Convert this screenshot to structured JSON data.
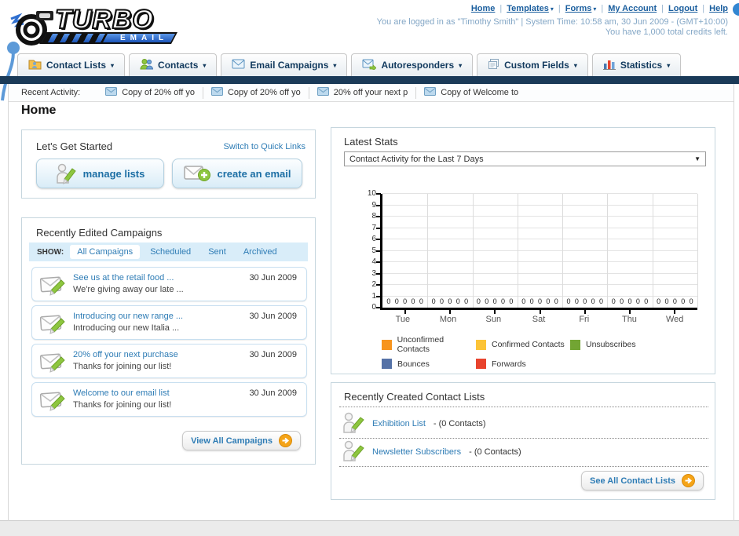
{
  "icons": {
    "chevron": "▾",
    "select_arrow": "▼",
    "separator": "|"
  },
  "header": {
    "logo_line1": "TURBO",
    "logo_line2": "EMAIL",
    "top_links": [
      {
        "label": "Home",
        "dropdown": false
      },
      {
        "label": "Templates",
        "dropdown": true
      },
      {
        "label": "Forms",
        "dropdown": true
      },
      {
        "label": "My Account",
        "dropdown": false
      },
      {
        "label": "Logout",
        "dropdown": false
      },
      {
        "label": "Help",
        "dropdown": false
      }
    ],
    "login_info": "You are logged in as \"Timothy Smith\" | System Time: 10:58 am, 30 Jun 2009 - (GMT+10:00)",
    "credits_info": "You have 1,000 total credits left."
  },
  "nav": {
    "tabs": [
      {
        "label": "Contact Lists",
        "icon": "contact-lists-folder-icon"
      },
      {
        "label": "Contacts",
        "icon": "contacts-people-icon"
      },
      {
        "label": "Email Campaigns",
        "icon": "envelope-icon"
      },
      {
        "label": "Autoresponders",
        "icon": "envelope-arrow-icon"
      },
      {
        "label": "Custom Fields",
        "icon": "pages-icon"
      },
      {
        "label": "Statistics",
        "icon": "bar-chart-icon"
      }
    ]
  },
  "recent_activity": {
    "label": "Recent Activity:",
    "items": [
      "Copy of 20% off yo",
      "Copy of 20% off yo",
      "20% off your next p",
      "Copy of Welcome to"
    ]
  },
  "page_title": "Home",
  "get_started": {
    "title": "Let's Get Started",
    "switch_link": "Switch to Quick Links",
    "manage_lists_label": "manage lists",
    "create_email_label": "create an email"
  },
  "campaigns": {
    "title": "Recently Edited Campaigns",
    "show_label": "SHOW:",
    "tabs": [
      {
        "label": "All Campaigns",
        "active": true
      },
      {
        "label": "Scheduled",
        "active": false
      },
      {
        "label": "Sent",
        "active": false
      },
      {
        "label": "Archived",
        "active": false
      }
    ],
    "items": [
      {
        "title": "See us at the retail food ...",
        "subtitle": "We're giving away our late ...",
        "date": "30 Jun 2009"
      },
      {
        "title": "Introducing our new range ...",
        "subtitle": "Introducing our new Italia ...",
        "date": "30 Jun 2009"
      },
      {
        "title": "20% off your next purchase",
        "subtitle": "Thanks for joining our list!",
        "date": "30 Jun 2009"
      },
      {
        "title": "Welcome to our email list",
        "subtitle": "Thanks for joining our list!",
        "date": "30 Jun 2009"
      }
    ],
    "view_all_label": "View All Campaigns"
  },
  "stats": {
    "title": "Latest Stats",
    "dropdown_value": "Contact Activity for the Last 7 Days"
  },
  "chart_data": {
    "type": "bar",
    "categories": [
      "Tue",
      "Mon",
      "Sun",
      "Sat",
      "Fri",
      "Thu",
      "Wed"
    ],
    "series": [
      {
        "name": "Unconfirmed Contacts",
        "color": "#f7941d",
        "values": [
          0,
          0,
          0,
          0,
          0,
          0,
          0
        ]
      },
      {
        "name": "Confirmed Contacts",
        "color": "#fcc438",
        "values": [
          0,
          0,
          0,
          0,
          0,
          0,
          0
        ]
      },
      {
        "name": "Unsubscribes",
        "color": "#72a533",
        "values": [
          0,
          0,
          0,
          0,
          0,
          0,
          0
        ]
      },
      {
        "name": "Bounces",
        "color": "#5572a7",
        "values": [
          0,
          0,
          0,
          0,
          0,
          0,
          0
        ]
      },
      {
        "name": "Forwards",
        "color": "#e8432d",
        "values": [
          0,
          0,
          0,
          0,
          0,
          0,
          0
        ]
      }
    ],
    "title": "Contact Activity for the Last 7 Days",
    "xlabel": "",
    "ylabel": "",
    "ylim": [
      0,
      10
    ],
    "yticks": [
      0,
      1,
      2,
      3,
      4,
      5,
      6,
      7,
      8,
      9,
      10
    ],
    "grid": true,
    "legend_position": "bottom"
  },
  "contact_lists": {
    "title": "Recently Created Contact Lists",
    "items": [
      {
        "name": "Exhibition List",
        "suffix": "- (0 Contacts)"
      },
      {
        "name": "Newsletter Subscribers",
        "suffix": "- (0 Contacts)"
      }
    ],
    "see_all_label": "See All Contact Lists"
  }
}
